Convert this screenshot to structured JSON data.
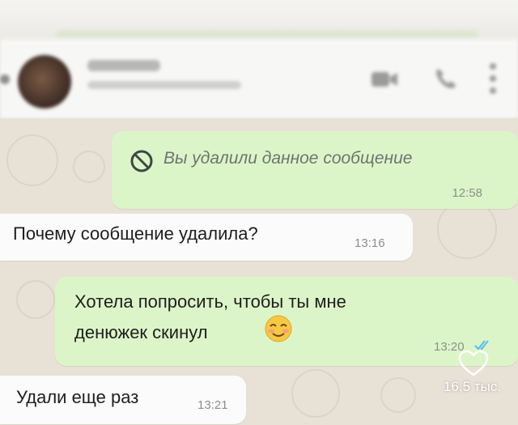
{
  "header": {
    "contact_name": "",
    "contact_status": "",
    "icons": [
      "back-icon",
      "avatar",
      "video-call-icon",
      "phone-call-icon",
      "menu-icon"
    ]
  },
  "messages": [
    {
      "direction": "outgoing",
      "deleted": true,
      "text": "Вы удалили данное сообщение",
      "time": "12:58",
      "icon": "ban-icon"
    },
    {
      "direction": "incoming",
      "text": "Почему сообщение удалила?",
      "time": "13:16"
    },
    {
      "direction": "outgoing",
      "text_line1": "Хотела попросить, чтобы ты мне",
      "text_line2": "денюжек скинул",
      "emoji": "smiling-face-icon",
      "time": "13:20",
      "status": "read"
    },
    {
      "direction": "incoming",
      "text": "Удали еще раз",
      "time": "13:21"
    }
  ],
  "overlay": {
    "likes": "16,5 тыс."
  },
  "colors": {
    "outgoing_bubble": "#dcf5c8",
    "incoming_bubble": "#fbfbfb",
    "chat_background": "#e8e2d6",
    "read_ticks": "#53bdeb"
  }
}
